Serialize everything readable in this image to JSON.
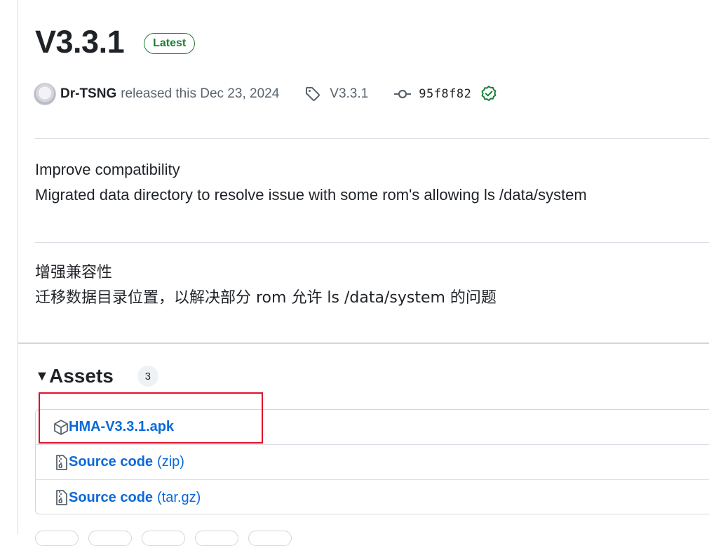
{
  "release": {
    "title": "V3.3.1",
    "badge": "Latest",
    "author": "Dr-TSNG",
    "released_text": "released this Dec 23, 2024",
    "tag": "V3.3.1",
    "commit": "95f8f82",
    "verified": true
  },
  "notes": {
    "en": [
      "Improve compatibility",
      "Migrated data directory to resolve issue with some rom's allowing ls /data/system"
    ],
    "zh": [
      "增强兼容性",
      "迁移数据目录位置，以解决部分 rom 允许 ls /data/system 的问题"
    ]
  },
  "assets": {
    "title": "Assets",
    "count": "3",
    "items": [
      {
        "name": "HMA-V3.3.1.apk",
        "suffix": "",
        "icon": "package-icon"
      },
      {
        "name": "Source code",
        "suffix": "(zip)",
        "icon": "file-zip-icon"
      },
      {
        "name": "Source code",
        "suffix": "(tar.gz)",
        "icon": "file-zip-icon"
      }
    ]
  },
  "colors": {
    "accent": "#0969da",
    "success": "#1a7f37",
    "highlight": "#e0102a"
  }
}
